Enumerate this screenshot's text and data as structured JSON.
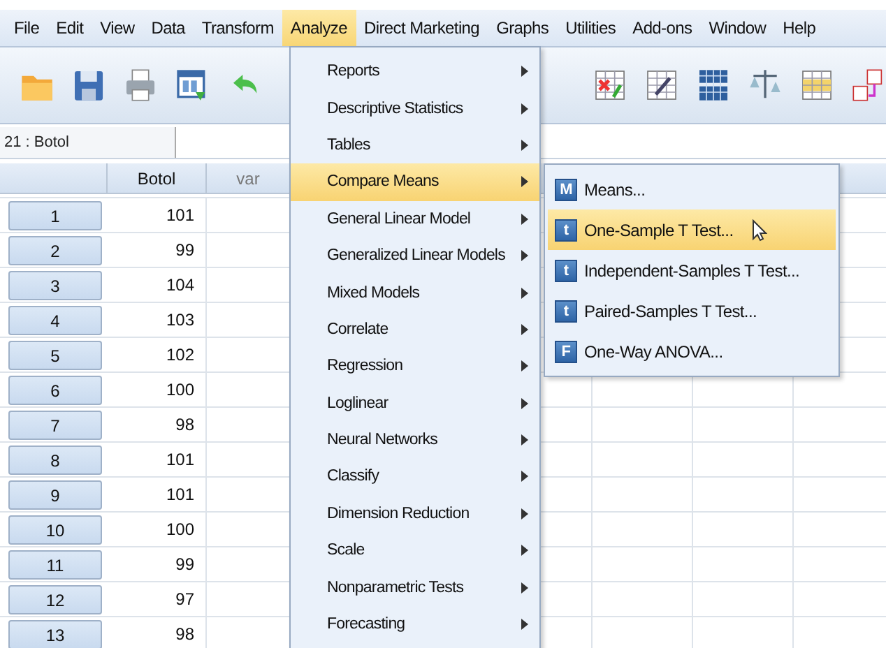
{
  "menubar": [
    {
      "label": "File",
      "selected": false
    },
    {
      "label": "Edit",
      "selected": false
    },
    {
      "label": "View",
      "selected": false
    },
    {
      "label": "Data",
      "selected": false
    },
    {
      "label": "Transform",
      "selected": false
    },
    {
      "label": "Analyze",
      "selected": true
    },
    {
      "label": "Direct Marketing",
      "selected": false
    },
    {
      "label": "Graphs",
      "selected": false
    },
    {
      "label": "Utilities",
      "selected": false
    },
    {
      "label": "Add-ons",
      "selected": false
    },
    {
      "label": "Window",
      "selected": false
    },
    {
      "label": "Help",
      "selected": false
    }
  ],
  "cell_reference": "21 : Botol",
  "table": {
    "columns": [
      "Botol",
      "var"
    ],
    "rows": [
      {
        "number": "1",
        "botol": "101"
      },
      {
        "number": "2",
        "botol": "99"
      },
      {
        "number": "3",
        "botol": "104"
      },
      {
        "number": "4",
        "botol": "103"
      },
      {
        "number": "5",
        "botol": "102"
      },
      {
        "number": "6",
        "botol": "100"
      },
      {
        "number": "7",
        "botol": "98"
      },
      {
        "number": "8",
        "botol": "101"
      },
      {
        "number": "9",
        "botol": "101"
      },
      {
        "number": "10",
        "botol": "100"
      },
      {
        "number": "11",
        "botol": "99"
      },
      {
        "number": "12",
        "botol": "97"
      },
      {
        "number": "13",
        "botol": "98"
      }
    ]
  },
  "analyze_menu": [
    {
      "label": "Reports",
      "selected": false
    },
    {
      "label": "Descriptive Statistics",
      "selected": false
    },
    {
      "label": "Tables",
      "selected": false
    },
    {
      "label": "Compare Means",
      "selected": true
    },
    {
      "label": "General Linear Model",
      "selected": false
    },
    {
      "label": "Generalized Linear Models",
      "selected": false
    },
    {
      "label": "Mixed Models",
      "selected": false
    },
    {
      "label": "Correlate",
      "selected": false
    },
    {
      "label": "Regression",
      "selected": false
    },
    {
      "label": "Loglinear",
      "selected": false
    },
    {
      "label": "Neural Networks",
      "selected": false
    },
    {
      "label": "Classify",
      "selected": false
    },
    {
      "label": "Dimension Reduction",
      "selected": false
    },
    {
      "label": "Scale",
      "selected": false
    },
    {
      "label": "Nonparametric Tests",
      "selected": false
    },
    {
      "label": "Forecasting",
      "selected": false
    }
  ],
  "compare_means_menu": [
    {
      "label": "Means...",
      "icon": "M",
      "selected": false
    },
    {
      "label": "One-Sample T Test...",
      "icon": "t",
      "selected": true
    },
    {
      "label": "Independent-Samples T Test...",
      "icon": "t",
      "selected": false
    },
    {
      "label": "Paired-Samples T Test...",
      "icon": "t",
      "selected": false
    },
    {
      "label": "One-Way ANOVA...",
      "icon": "F",
      "selected": false
    }
  ]
}
